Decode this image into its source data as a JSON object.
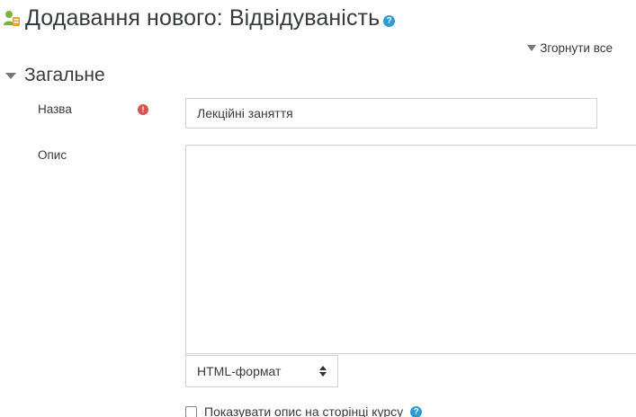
{
  "header": {
    "title": "Додавання нового: Відвідуваність",
    "module_icon": "attendance-icon",
    "help_icon": "question-icon",
    "help_symbol": "?"
  },
  "toolbar": {
    "collapse_all_label": "Згорнути все"
  },
  "section": {
    "title": "Загальне",
    "expanded": true
  },
  "fields": {
    "name": {
      "label": "Назва",
      "value": "Лекційні заняття",
      "required": true,
      "required_symbol": "!"
    },
    "description": {
      "label": "Опис",
      "value": ""
    },
    "format": {
      "selected": "HTML-формат"
    },
    "show_description": {
      "label": "Показувати опис на сторінці курсу",
      "checked": false,
      "help_symbol": "?"
    }
  },
  "colors": {
    "help_blue": "#2f9ad1",
    "required_red": "#d9534f",
    "text": "#373a3c",
    "border": "#ced4da"
  }
}
